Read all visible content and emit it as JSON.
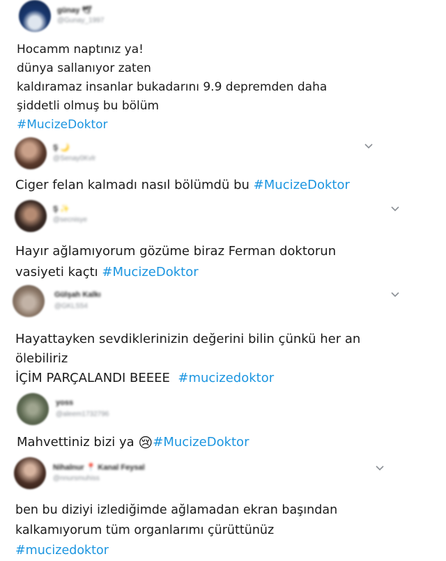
{
  "tweets": [
    {
      "name": "günay 🕊",
      "handle": "@Gunay_1997",
      "lines": [
        "Hocamm naptınız ya!",
        "dünya sallanıyor zaten",
        "kaldıramaz insanlar bukadarını 9.9 depremden daha",
        "şiddetli olmuş bu bölüm"
      ],
      "hashtag": "#MucizeDoktor"
    },
    {
      "name": "Ş 🌙",
      "handle": "@Senay0Kvlr",
      "lines": [
        "Ciger felan kalmadı nasıl bölümdü bu"
      ],
      "hashtag": "#MucizeDoktor"
    },
    {
      "name": "Ş ✨",
      "handle": "@secnisye",
      "lines": [
        "Hayır ağlamıyorum gözüme biraz Ferman doktorun",
        "vasiyeti kaçtı"
      ],
      "hashtag": "#MucizeDoktor"
    },
    {
      "name": "Gülşah Kalkı",
      "handle": "@GKLS54",
      "lines": [
        "Hayattayken sevdiklerinizin değerini bilin çünkü her an",
        "ölebiliriz",
        "İÇİM PARÇALANDI BEEEE"
      ],
      "hashtag": "#mucizedoktor"
    },
    {
      "name": "yoss",
      "handle": "@aleem1732796",
      "lines": [
        "Mahvettiniz bizi ya"
      ],
      "emoji": "😢",
      "hashtag": "#MucizeDoktor"
    },
    {
      "name": "Nihalnur 📍 Kanal Feysal",
      "handle": "@nnursmuhiss",
      "lines": [
        "ben bu diziyi izlediğimde ağlamadan ekran başından",
        "kalkamıyorum tüm organlarımı çürüttünüz"
      ],
      "hashtag": "#mucizedoktor"
    }
  ],
  "colors": {
    "hashtag": "#1b95e0",
    "text": "#1b1b1b",
    "handle": "#8a8f95"
  },
  "icons": {
    "more": "chevron-down-icon"
  }
}
